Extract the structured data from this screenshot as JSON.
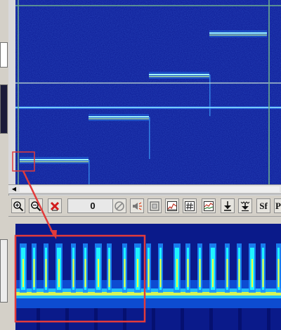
{
  "toolbar": {
    "value_display": "0",
    "extra_text": "Sf",
    "cut_label": "P",
    "buttons": [
      {
        "icon": "zoom-in-icon"
      },
      {
        "icon": "zoom-out-icon"
      },
      {
        "icon": "delete-x-icon"
      },
      {
        "icon": "no-entry-icon"
      },
      {
        "icon": "speaker-icon"
      },
      {
        "icon": "frame-icon"
      },
      {
        "icon": "spectrum-graph-icon"
      },
      {
        "icon": "grid-hash-icon"
      },
      {
        "icon": "line-graph-icon"
      },
      {
        "icon": "arrow-down-icon"
      },
      {
        "icon": "double-arrow-down-icon"
      },
      {
        "icon": "sf-icon"
      }
    ]
  },
  "colors": {
    "waterfall_bg": "#0b1aa8",
    "cursor_lines": "#6fae8f",
    "zoom_marker": "#e23b3b",
    "toolbar_bg": "#d4d0c8"
  },
  "waterfall": {
    "signal_steps": 4,
    "has_carrier_line": true
  }
}
